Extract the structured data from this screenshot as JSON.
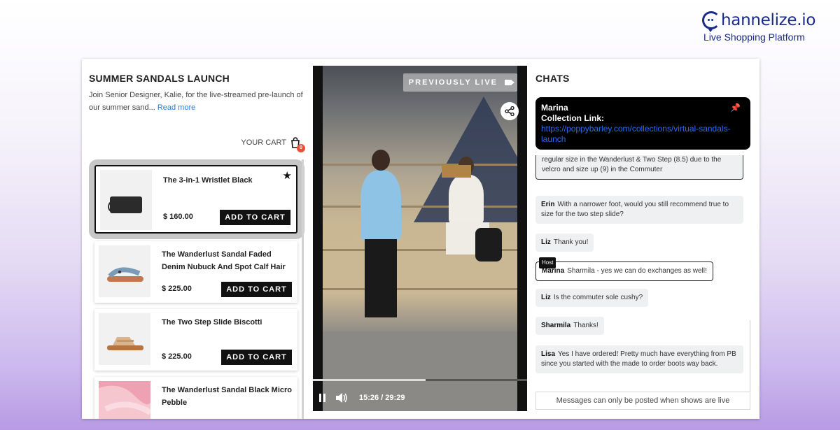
{
  "brand": {
    "name": "hannelize.io",
    "tagline": "Live Shopping Platform"
  },
  "show": {
    "title": "SUMMER SANDALS LAUNCH",
    "description": "Join Senior Designer, Kalie, for the live-streamed pre-launch of our summer sand...",
    "read_more": "Read more"
  },
  "cart": {
    "label": "YOUR CART",
    "count": "0"
  },
  "products": [
    {
      "name": "The 3-in-1 Wristlet Black",
      "price": "$ 160.00",
      "button": "ADD TO CART",
      "favorited": true
    },
    {
      "name": "The Wanderlust Sandal Faded Denim Nubuck And Spot Calf Hair",
      "price": "$ 225.00",
      "button": "ADD TO CART"
    },
    {
      "name": "The Two Step Slide Biscotti",
      "price": "$ 225.00",
      "button": "ADD TO CART"
    },
    {
      "name": "The Wanderlust Sandal Black Micro Pebble",
      "price": "",
      "button": ""
    }
  ],
  "video": {
    "status_label": "PREVIOUSLY LIVE",
    "time": "15:26 / 29:29",
    "progress": 0.525
  },
  "chats": {
    "title": "CHATS",
    "pinned": {
      "author": "Marina",
      "label": "Collection Link:",
      "link": "https://poppybarley.com/collections/virtual-sandals-launch"
    },
    "messages": [
      {
        "author": "",
        "text": "regular size in the Wanderlust & Two Step (8.5) due to the velcro and size up (9) in the Commuter",
        "host": false
      },
      {
        "author": "Erin",
        "text": "With a narrower foot, would you still recommend true to size for the two step slide?",
        "host": false
      },
      {
        "author": "Liz",
        "text": "Thank you!",
        "host": false
      },
      {
        "author": "Marina",
        "text": "Sharmila - yes we can do exchanges as well!",
        "host": true,
        "tag": "Host"
      },
      {
        "author": "Liz",
        "text": "Is the commuter sole cushy?",
        "host": false
      },
      {
        "author": "Sharmila",
        "text": "Thanks!",
        "host": false
      },
      {
        "author": "Lisa",
        "text": "Yes I have ordered! Pretty much have everything from PB since you started with the made to order boots way back.",
        "host": false
      }
    ],
    "notice": "Messages can only be posted when shows are live"
  },
  "colors": {
    "brand": "#1a2a8a",
    "badge": "#e8503a",
    "link": "#2a7ad8",
    "pinned_link": "#2a6cf0"
  }
}
